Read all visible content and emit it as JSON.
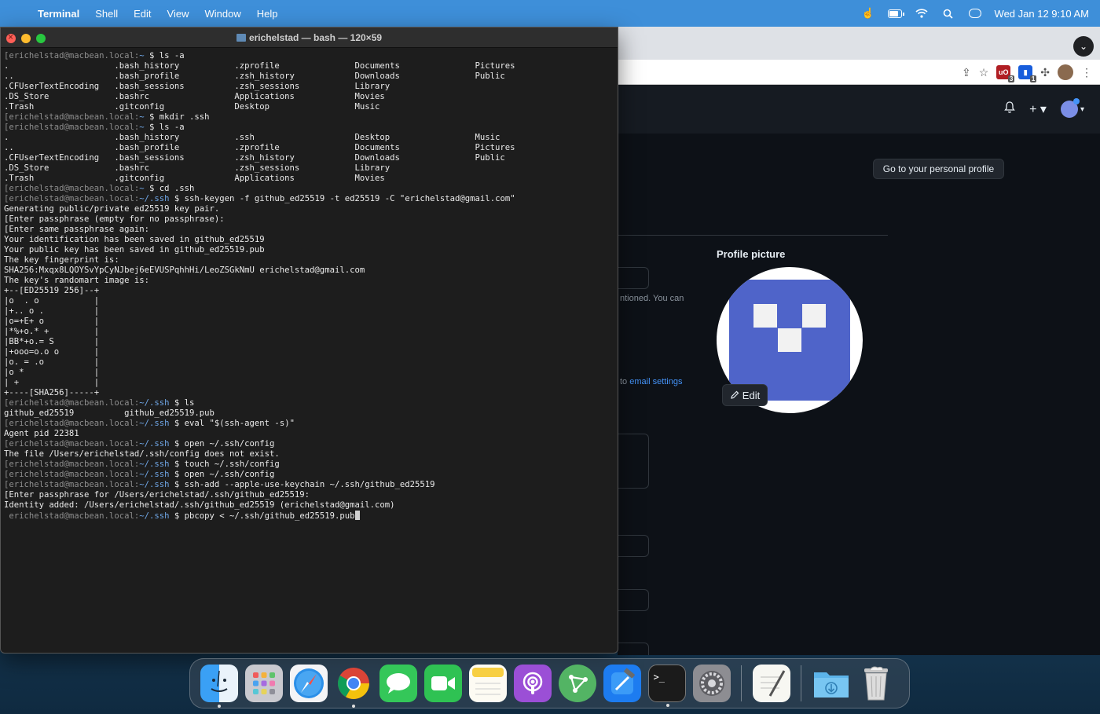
{
  "menubar": {
    "app_name": "Terminal",
    "menus": [
      "Shell",
      "Edit",
      "View",
      "Window",
      "Help"
    ],
    "datetime": "Wed Jan 12  9:10 AM"
  },
  "terminal": {
    "title": "erichelstad — bash — 120×59",
    "lines": [
      {
        "user": "[erichelstad@macbean.local:",
        "dir": "~",
        "cmd": " $ ls -a"
      },
      {
        "text": ".                     .bash_history           .zprofile               Documents               Pictures"
      },
      {
        "text": "..                    .bash_profile           .zsh_history            Downloads               Public"
      },
      {
        "text": ".CFUserTextEncoding   .bash_sessions          .zsh_sessions           Library"
      },
      {
        "text": ".DS_Store             .bashrc                 Applications            Movies"
      },
      {
        "text": ".Trash                .gitconfig              Desktop                 Music"
      },
      {
        "user": "[erichelstad@macbean.local:",
        "dir": "~",
        "cmd": " $ mkdir .ssh"
      },
      {
        "user": "[erichelstad@macbean.local:",
        "dir": "~",
        "cmd": " $ ls -a"
      },
      {
        "text": ".                     .bash_history           .ssh                    Desktop                 Music"
      },
      {
        "text": "..                    .bash_profile           .zprofile               Documents               Pictures"
      },
      {
        "text": ".CFUserTextEncoding   .bash_sessions          .zsh_history            Downloads               Public"
      },
      {
        "text": ".DS_Store             .bashrc                 .zsh_sessions           Library"
      },
      {
        "text": ".Trash                .gitconfig              Applications            Movies"
      },
      {
        "user": "[erichelstad@macbean.local:",
        "dir": "~",
        "cmd": " $ cd .ssh"
      },
      {
        "user": "[erichelstad@macbean.local:",
        "dir": "~/.ssh",
        "cmd": " $ ssh-keygen -f github_ed25519 -t ed25519 -C \"erichelstad@gmail.com\""
      },
      {
        "text": "Generating public/private ed25519 key pair."
      },
      {
        "text": "[Enter passphrase (empty for no passphrase):"
      },
      {
        "text": "[Enter same passphrase again:"
      },
      {
        "text": "Your identification has been saved in github_ed25519"
      },
      {
        "text": "Your public key has been saved in github_ed25519.pub"
      },
      {
        "text": "The key fingerprint is:"
      },
      {
        "text": "SHA256:Mxqx8LQOYSvYpCyNJbej6eEVUSPqhhHi/LeoZSGkNmU erichelstad@gmail.com"
      },
      {
        "text": "The key's randomart image is:"
      },
      {
        "text": "+--[ED25519 256]--+"
      },
      {
        "text": "|o  . o           |"
      },
      {
        "text": "|+.. o .          |"
      },
      {
        "text": "|o=+E+ o          |"
      },
      {
        "text": "|*%+o.* +         |"
      },
      {
        "text": "|BB*+o.= S        |"
      },
      {
        "text": "|+ooo=o.o o       |"
      },
      {
        "text": "|o. = .o          |"
      },
      {
        "text": "|o *              |"
      },
      {
        "text": "| +               |"
      },
      {
        "text": "+----[SHA256]-----+"
      },
      {
        "user": "[erichelstad@macbean.local:",
        "dir": "~/.ssh",
        "cmd": " $ ls"
      },
      {
        "text": "github_ed25519          github_ed25519.pub"
      },
      {
        "user": "[erichelstad@macbean.local:",
        "dir": "~/.ssh",
        "cmd": " $ eval \"$(ssh-agent -s)\""
      },
      {
        "text": "Agent pid 22381"
      },
      {
        "user": "[erichelstad@macbean.local:",
        "dir": "~/.ssh",
        "cmd": " $ open ~/.ssh/config"
      },
      {
        "text": "The file /Users/erichelstad/.ssh/config does not exist."
      },
      {
        "user": "[erichelstad@macbean.local:",
        "dir": "~/.ssh",
        "cmd": " $ touch ~/.ssh/config"
      },
      {
        "user": "[erichelstad@macbean.local:",
        "dir": "~/.ssh",
        "cmd": " $ open ~/.ssh/config"
      },
      {
        "user": "[erichelstad@macbean.local:",
        "dir": "~/.ssh",
        "cmd": " $ ssh-add --apple-use-keychain ~/.ssh/github_ed25519"
      },
      {
        "text": "[Enter passphrase for /Users/erichelstad/.ssh/github_ed25519:"
      },
      {
        "text": "Identity added: /Users/erichelstad/.ssh/github_ed25519 (erichelstad@gmail.com)"
      },
      {
        "user": " erichelstad@macbean.local:",
        "dir": "~/.ssh",
        "cmd": " $ pbcopy < ~/.ssh/github_ed25519.pub",
        "cursor": true
      }
    ]
  },
  "browser": {
    "profile_button": "Go to your personal profile",
    "profile_picture_title": "Profile picture",
    "edit_label": "Edit",
    "note_fragment": "ntioned. You can",
    "email_prefix": "to ",
    "email_link": "email settings",
    "extension_badges": [
      "3",
      "1"
    ]
  },
  "dock": {
    "apps": [
      "finder",
      "launchpad",
      "safari",
      "chrome",
      "messages",
      "facetime",
      "notes",
      "podcasts",
      "git-client",
      "xcode",
      "terminal",
      "system-preferences"
    ],
    "after_separator": [
      "textedit"
    ],
    "stack": [
      "downloads",
      "trash"
    ]
  }
}
